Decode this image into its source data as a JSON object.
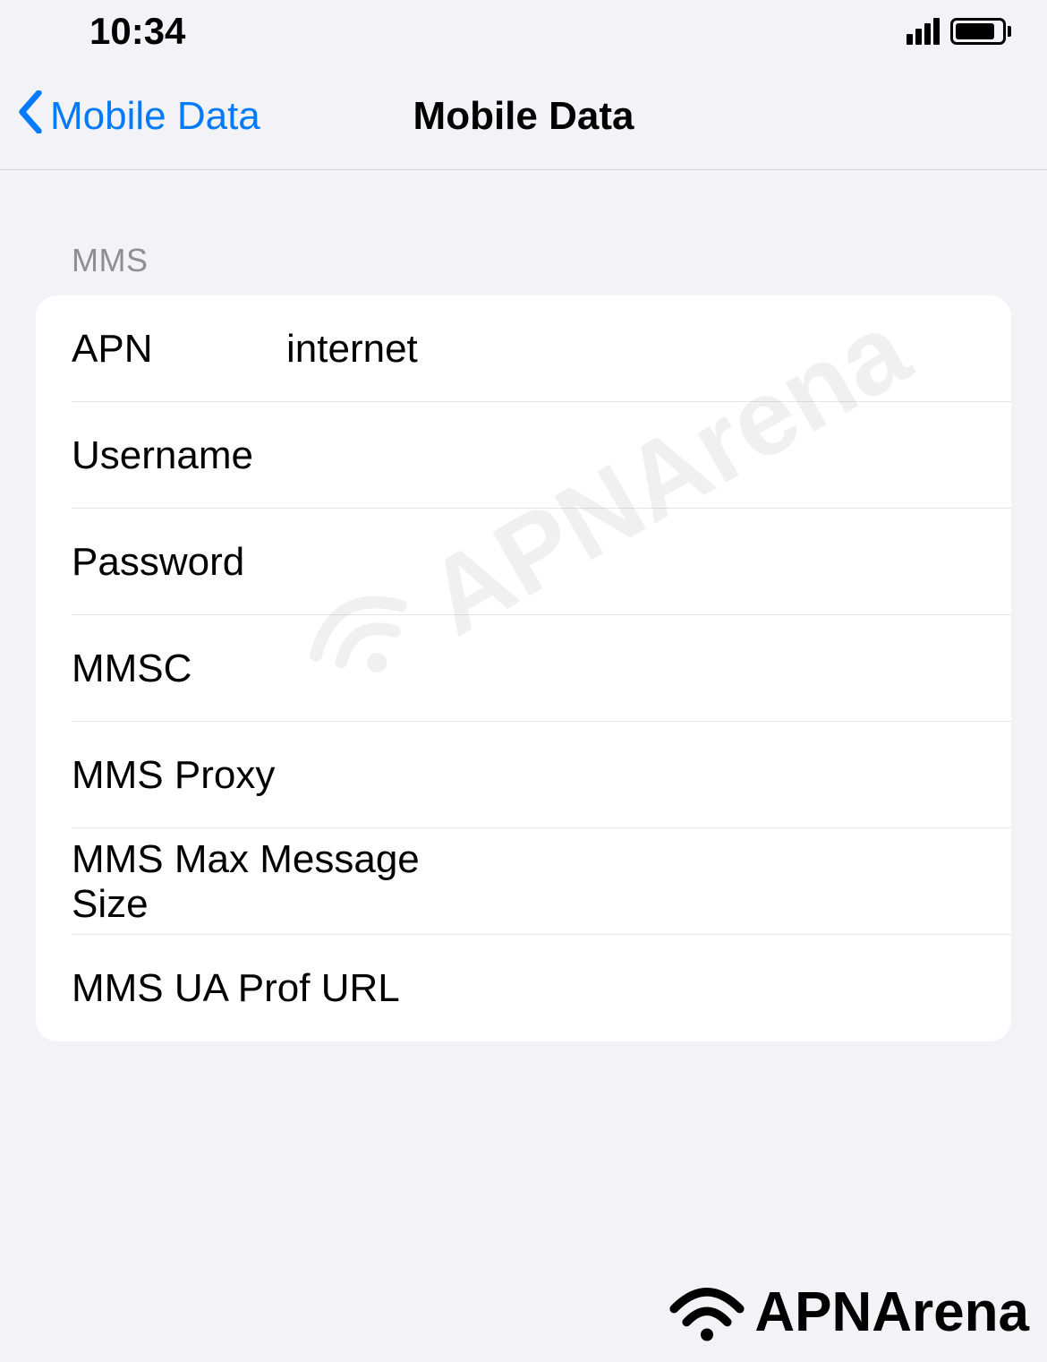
{
  "statusBar": {
    "time": "10:34"
  },
  "nav": {
    "backLabel": "Mobile Data",
    "title": "Mobile Data"
  },
  "section": {
    "header": "MMS",
    "rows": [
      {
        "label": "APN",
        "value": "internet"
      },
      {
        "label": "Username",
        "value": ""
      },
      {
        "label": "Password",
        "value": ""
      },
      {
        "label": "MMSC",
        "value": ""
      },
      {
        "label": "MMS Proxy",
        "value": ""
      },
      {
        "label": "MMS Max Message Size",
        "value": ""
      },
      {
        "label": "MMS UA Prof URL",
        "value": ""
      }
    ]
  },
  "watermark": "APNArena",
  "footerBrand": "APNArena"
}
